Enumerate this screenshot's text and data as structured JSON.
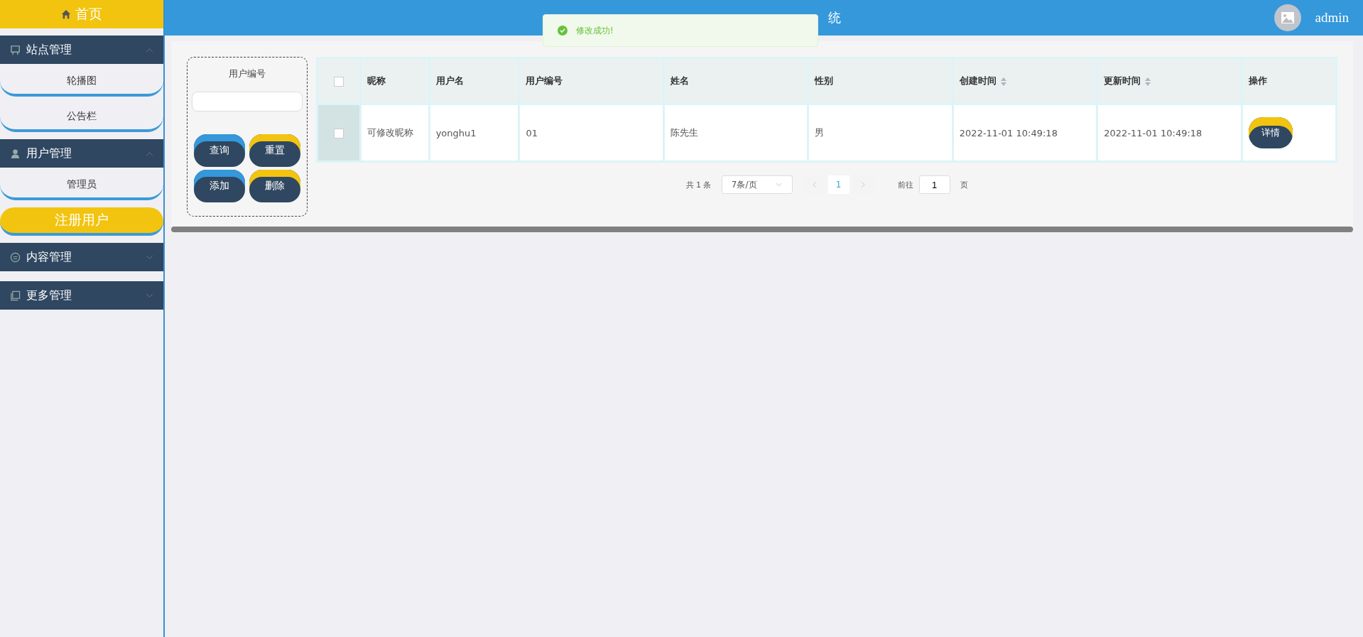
{
  "sidebar": {
    "home": "首页",
    "groups": [
      {
        "label": "站点管理",
        "expanded": true,
        "items": [
          {
            "label": "轮播图",
            "selected": false
          },
          {
            "label": "公告栏",
            "selected": false
          }
        ]
      },
      {
        "label": "用户管理",
        "expanded": true,
        "items": [
          {
            "label": "管理员",
            "selected": false
          },
          {
            "label": "注册用户",
            "selected": true
          }
        ]
      },
      {
        "label": "内容管理",
        "expanded": false
      },
      {
        "label": "更多管理",
        "expanded": false
      }
    ]
  },
  "header": {
    "title": "统",
    "user": "admin"
  },
  "toast": {
    "message": "修改成功!"
  },
  "search": {
    "label": "用户编号",
    "buttons": [
      {
        "label": "查询",
        "kind": "blue"
      },
      {
        "label": "重置",
        "kind": "yellow"
      },
      {
        "label": "添加",
        "kind": "blue"
      },
      {
        "label": "删除",
        "kind": "yellow"
      }
    ]
  },
  "table": {
    "all_checked": false,
    "columns": [
      {
        "label": "昵称",
        "sortable": false
      },
      {
        "label": "用户名",
        "sortable": false
      },
      {
        "label": "用户编号",
        "sortable": false
      },
      {
        "label": "姓名",
        "sortable": false
      },
      {
        "label": "性别",
        "sortable": false
      },
      {
        "label": "创建时间",
        "sortable": true
      },
      {
        "label": "更新时间",
        "sortable": true
      },
      {
        "label": "操作",
        "sortable": false
      }
    ],
    "rows": [
      {
        "checked": false,
        "cells": [
          "可修改昵称",
          "yonghu1",
          "01",
          "陈先生",
          "男",
          "2022-11-01 10:49:18",
          "2022-11-01 10:49:18"
        ],
        "action": "详情"
      }
    ]
  },
  "pagination": {
    "total": "共 1 条",
    "page_size": "7条/页",
    "pages": [
      {
        "label": "1",
        "selected": true
      }
    ],
    "goto_label": "前往",
    "goto_value": "1",
    "goto_suffix": "页"
  }
}
